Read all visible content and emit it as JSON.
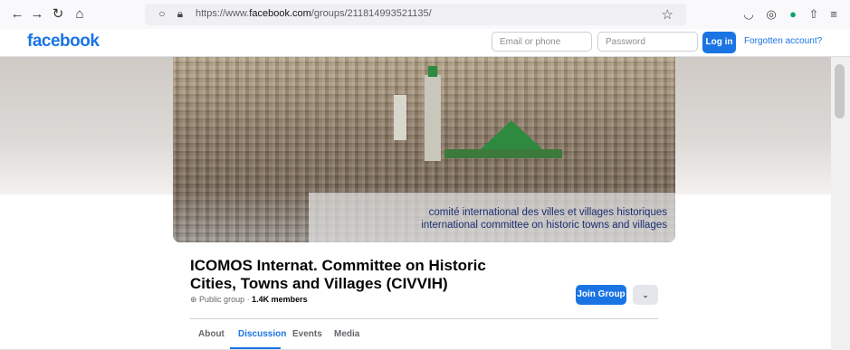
{
  "browser": {
    "url_prefix": "https://www.",
    "url_domain": "facebook.com",
    "url_path": "/groups/211814993521135/"
  },
  "header": {
    "logo": "facebook",
    "email_placeholder": "Email or phone",
    "password_placeholder": "Password",
    "login_label": "Log in",
    "forgot_label": "Forgotten account?"
  },
  "cover": {
    "caption_line1": "comité international des villes et villages historiques",
    "caption_line2": "international committee on historic towns and villages"
  },
  "group": {
    "title": "ICOMOS Internat. Committee on Historic Cities, Towns and Villages (CIVVIH)",
    "privacy": "Public group · ",
    "members": "1.4K members",
    "join_label": "Join Group",
    "more_label": "⌄"
  },
  "tabs": [
    {
      "label": "About",
      "active": false
    },
    {
      "label": "Discussion",
      "active": true
    },
    {
      "label": "Events",
      "active": false
    },
    {
      "label": "Media",
      "active": false
    }
  ],
  "colors": {
    "brand": "#1b74e4"
  }
}
